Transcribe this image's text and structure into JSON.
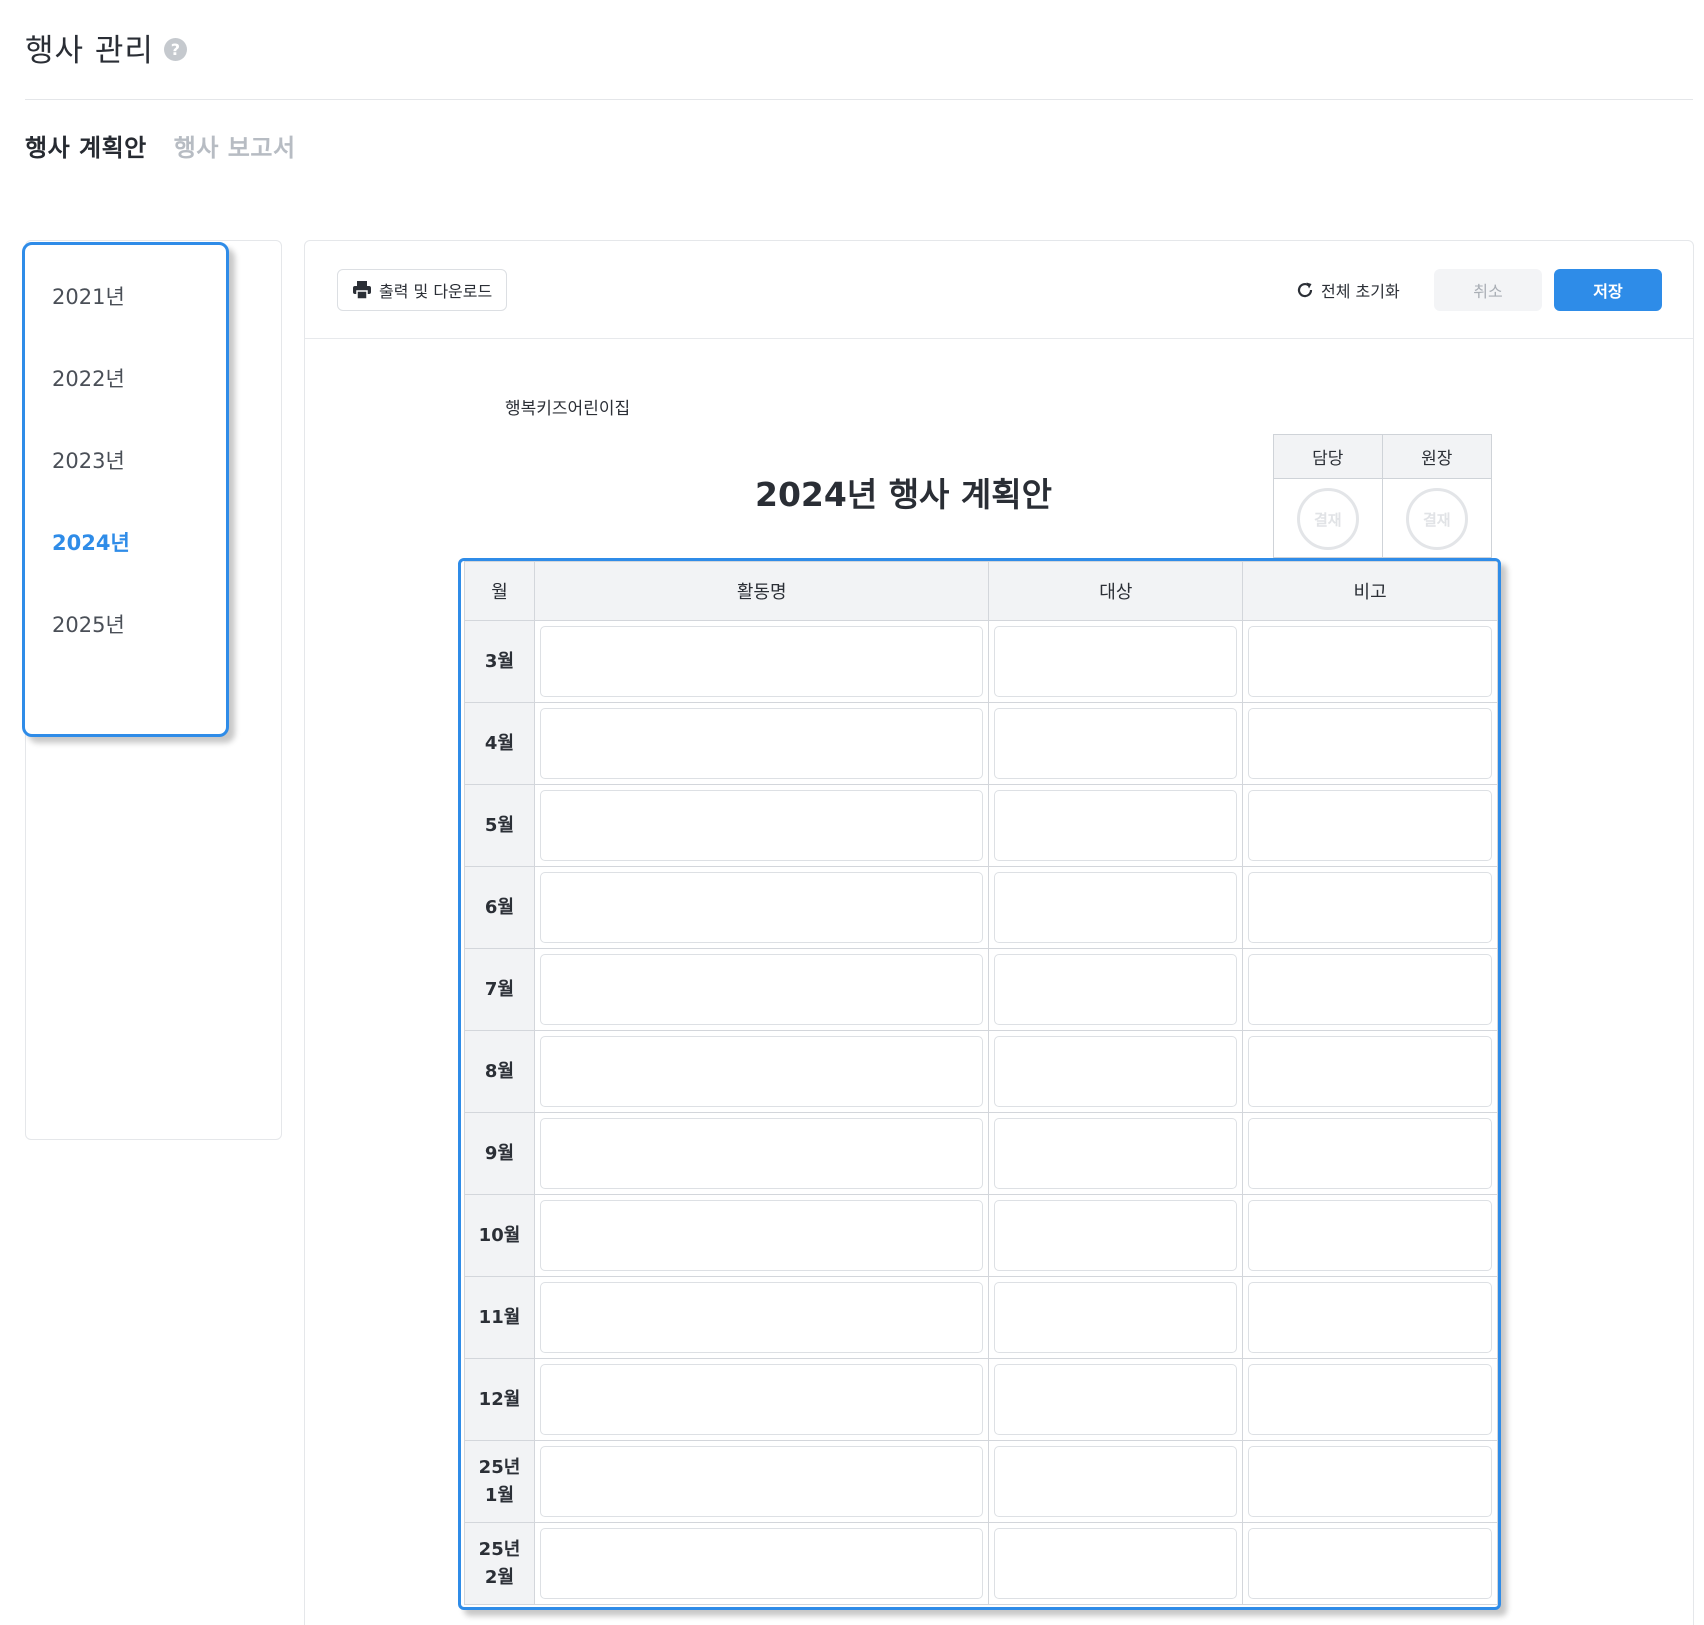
{
  "header": {
    "title": "행사 관리",
    "help_icon": "question-circle-icon"
  },
  "tabs": [
    {
      "label": "행사 계획안",
      "active": true
    },
    {
      "label": "행사 보고서",
      "active": false
    }
  ],
  "sidebar": {
    "years": [
      {
        "label": "2021년",
        "active": false
      },
      {
        "label": "2022년",
        "active": false
      },
      {
        "label": "2023년",
        "active": false
      },
      {
        "label": "2024년",
        "active": true
      },
      {
        "label": "2025년",
        "active": false
      }
    ]
  },
  "toolbar": {
    "print_label": "출력 및 다운로드",
    "print_icon": "printer-icon",
    "reset_label": "전체 초기화",
    "reset_icon": "refresh-icon",
    "cancel_label": "취소",
    "save_label": "저장"
  },
  "document": {
    "daycare_name": "행복키즈어린이집",
    "title": "2024년 행사 계획안",
    "approval": {
      "headers": [
        "담당",
        "원장"
      ],
      "stamp_label": "결재"
    },
    "table": {
      "headers": {
        "month": "월",
        "activity": "활동명",
        "target": "대상",
        "note": "비고"
      },
      "rows": [
        {
          "month": "3월"
        },
        {
          "month": "4월"
        },
        {
          "month": "5월"
        },
        {
          "month": "6월"
        },
        {
          "month": "7월"
        },
        {
          "month": "8월"
        },
        {
          "month": "9월"
        },
        {
          "month": "10월"
        },
        {
          "month": "11월"
        },
        {
          "month": "12월"
        },
        {
          "month_line1": "25년",
          "month_line2": "1월"
        },
        {
          "month_line1": "25년",
          "month_line2": "2월"
        }
      ]
    }
  },
  "colors": {
    "accent": "#2f8ce8",
    "muted": "#b7bcc3"
  }
}
